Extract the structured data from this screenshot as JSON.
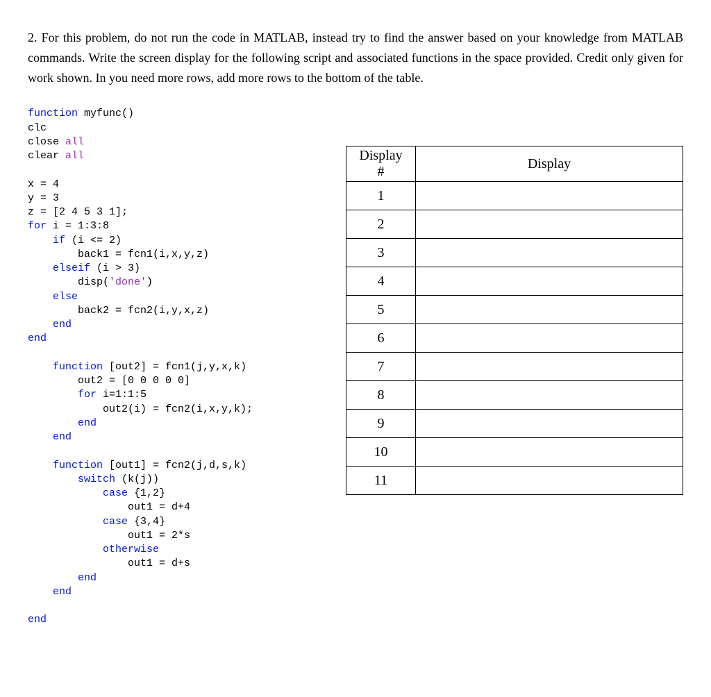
{
  "question": {
    "prefix": "2. ",
    "text": "For this problem, do not run the code in MATLAB, instead try to find the answer based on your knowledge from MATLAB commands. Write the screen display for the following script and associated functions in the space provided. Credit only given for work shown. In you need more rows, add more rows to the bottom of the table."
  },
  "code": {
    "l01_kw_function": "function",
    "l01_rest": " myfunc()",
    "l02": "clc",
    "l03_a": "close ",
    "l03_b": "all",
    "l04_a": "clear ",
    "l04_b": "all",
    "blank1": "",
    "l05": "x = 4",
    "l06": "y = 3",
    "l07": "z = [2 4 5 3 1];",
    "l08_a": "for",
    "l08_b": " i = 1:3:8",
    "l09_a": "    ",
    "l09_b": "if",
    "l09_c": " (i <= 2)",
    "l10": "        back1 = fcn1(i,x,y,z)",
    "l11_a": "    ",
    "l11_b": "elseif",
    "l11_c": " (i > 3)",
    "l12_a": "        disp(",
    "l12_b": "'done'",
    "l12_c": ")",
    "l13_a": "    ",
    "l13_b": "else",
    "l14": "        back2 = fcn2(i,y,x,z)",
    "l15_a": "    ",
    "l15_b": "end",
    "l16_a": "",
    "l16_b": "end",
    "blank2": "",
    "l17_a": "    ",
    "l17_b": "function",
    "l17_c": " [out2] = fcn1(j,y,x,k)",
    "l18": "        out2 = [0 0 0 0 0]",
    "l19_a": "        ",
    "l19_b": "for",
    "l19_c": " i=1:1:5",
    "l20": "            out2(i) = fcn2(i,x,y,k);",
    "l21_a": "        ",
    "l21_b": "end",
    "l22_a": "    ",
    "l22_b": "end",
    "blank3": "",
    "l23_a": "    ",
    "l23_b": "function",
    "l23_c": " [out1] = fcn2(j,d,s,k)",
    "l24_a": "        ",
    "l24_b": "switch",
    "l24_c": " (k(j))",
    "l25_a": "            ",
    "l25_b": "case",
    "l25_c": " {1,2}",
    "l26": "                out1 = d+4",
    "l27_a": "            ",
    "l27_b": "case",
    "l27_c": " {3,4}",
    "l28": "                out1 = 2*s",
    "l29_a": "            ",
    "l29_b": "otherwise",
    "l30": "                out1 = d+s",
    "l31_a": "        ",
    "l31_b": "end",
    "l32_a": "    ",
    "l32_b": "end",
    "blank4": "",
    "l33_a": "",
    "l33_b": "end"
  },
  "table": {
    "head_num_line1": "Display",
    "head_num_line2": "#",
    "head_disp": "Display",
    "rows": [
      {
        "n": "1",
        "v": ""
      },
      {
        "n": "2",
        "v": ""
      },
      {
        "n": "3",
        "v": ""
      },
      {
        "n": "4",
        "v": ""
      },
      {
        "n": "5",
        "v": ""
      },
      {
        "n": "6",
        "v": ""
      },
      {
        "n": "7",
        "v": ""
      },
      {
        "n": "8",
        "v": ""
      },
      {
        "n": "9",
        "v": ""
      },
      {
        "n": "10",
        "v": ""
      },
      {
        "n": "11",
        "v": ""
      }
    ]
  }
}
